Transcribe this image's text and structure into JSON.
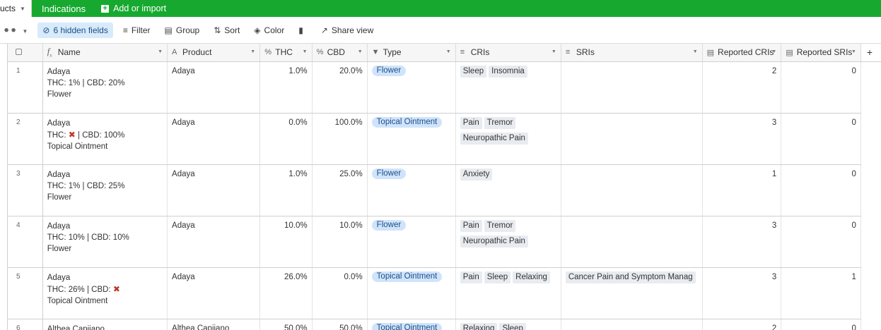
{
  "tabs": {
    "active": "ucts",
    "second": "Indications",
    "add_import": "Add or import"
  },
  "toolbar": {
    "hidden_fields": "6 hidden fields",
    "filter": "Filter",
    "group": "Group",
    "sort": "Sort",
    "color": "Color",
    "share": "Share view"
  },
  "columns": {
    "name": "Name",
    "product": "Product",
    "thc": "THC",
    "cbd": "CBD",
    "type": "Type",
    "cris": "CRIs",
    "sris": "SRIs",
    "reported_cris": "Reported CRIs",
    "reported_sris": "Reported SRIs"
  },
  "rows": [
    {
      "num": "1",
      "name1": "Adaya",
      "name2a": "THC: 1% | CBD: 20%",
      "name3": "Flower",
      "product": "Adaya",
      "thc": "1.0%",
      "cbd": "20.0%",
      "type": "Flower",
      "cris": [
        "Sleep",
        "Insomnia"
      ],
      "sris": "",
      "rcris": "2",
      "rsris": "0"
    },
    {
      "num": "2",
      "name1": "Adaya",
      "name2a": "THC:",
      "name2b": "| CBD: 100%",
      "name3": "Topical Ointment",
      "product": "Adaya",
      "thc": "0.0%",
      "cbd": "100.0%",
      "type": "Topical Ointment",
      "cris": [
        "Pain",
        "Tremor",
        "Neuropathic Pain"
      ],
      "sris": "",
      "rcris": "3",
      "rsris": "0"
    },
    {
      "num": "3",
      "name1": "Adaya",
      "name2a": "THC: 1% | CBD: 25%",
      "name3": "Flower",
      "product": "Adaya",
      "thc": "1.0%",
      "cbd": "25.0%",
      "type": "Flower",
      "cris": [
        "Anxiety"
      ],
      "sris": "",
      "rcris": "1",
      "rsris": "0"
    },
    {
      "num": "4",
      "name1": "Adaya",
      "name2a": "THC: 10% | CBD: 10%",
      "name3": "Flower",
      "product": "Adaya",
      "thc": "10.0%",
      "cbd": "10.0%",
      "type": "Flower",
      "cris": [
        "Pain",
        "Tremor",
        "Neuropathic Pain"
      ],
      "sris": "",
      "rcris": "3",
      "rsris": "0"
    },
    {
      "num": "5",
      "name1": "Adaya",
      "name2a": "THC: 26% | CBD:",
      "name3": "Topical Ointment",
      "product": "Adaya",
      "thc": "26.0%",
      "cbd": "0.0%",
      "type": "Topical Ointment",
      "cris": [
        "Pain",
        "Sleep",
        "Relaxing"
      ],
      "sris": "Cancer Pain and Symptom Manag",
      "rcris": "3",
      "rsris": "1"
    },
    {
      "num": "6",
      "name1": "Althea Capiiano",
      "product": "Althea Capiiano",
      "thc": "50.0%",
      "cbd": "50.0%",
      "type": "Topical Ointment",
      "cris": [
        "Relaxing",
        "Sleep"
      ],
      "rcris": "2",
      "rsris": "0"
    }
  ]
}
